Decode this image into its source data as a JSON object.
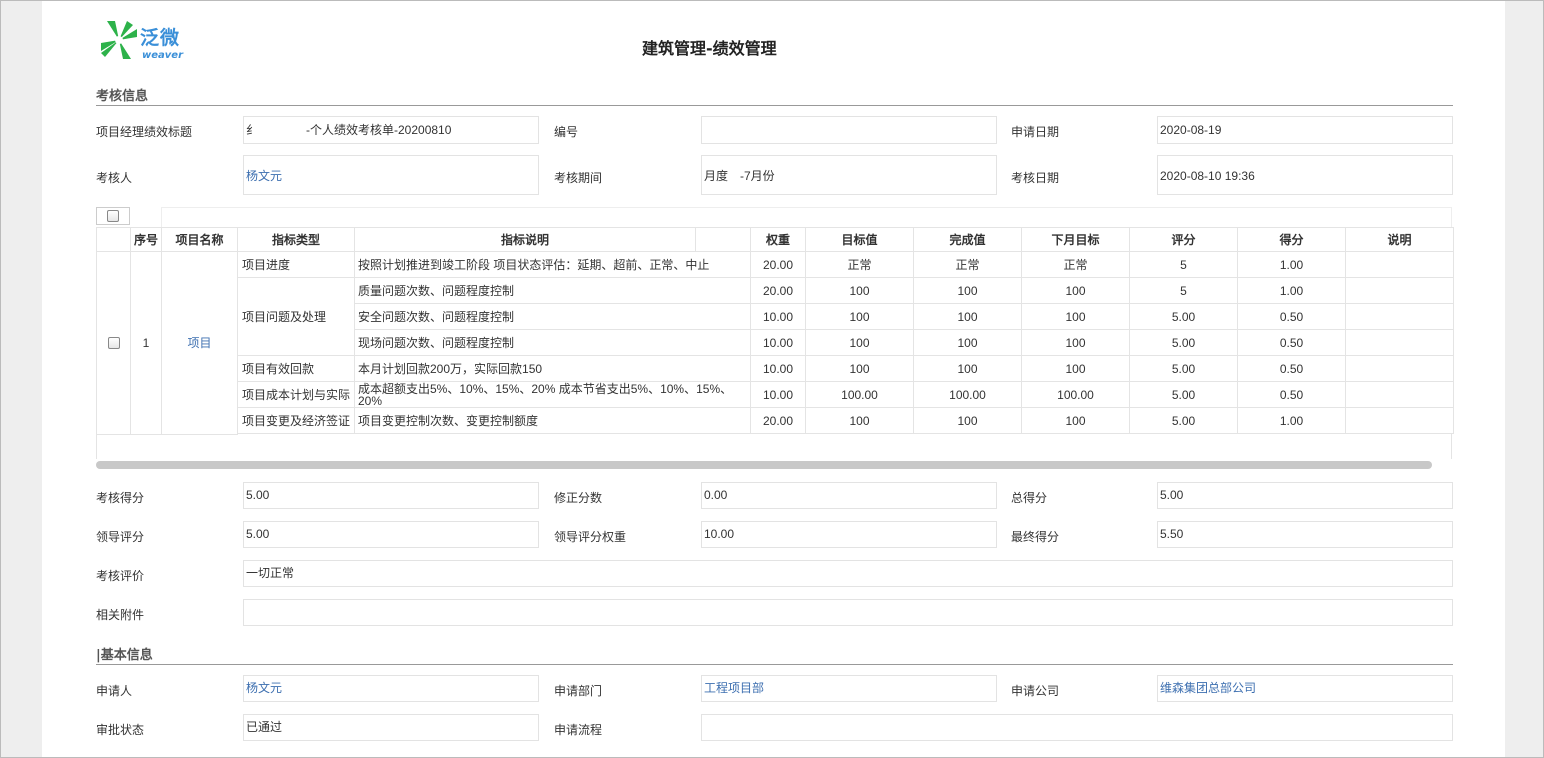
{
  "app": {
    "logo_text": "泛微",
    "logo_sub": "weaver",
    "title": "建筑管理-绩效管理"
  },
  "colors": {
    "link": "#3d6fb0",
    "logo": "#3a8fd8",
    "logo_green": "#2db24a"
  },
  "icons": {
    "logo": "weaver-pinwheel-icon",
    "checkbox": "checkbox-icon"
  },
  "section_assess": {
    "title": "考核信息",
    "fields": {
      "pm_title_label": "项目经理绩效标题",
      "pm_title_value": "-个人绩效考核单-20200810",
      "pm_title_prefix": "纟",
      "number_label": "编号",
      "number_value": "",
      "apply_date_label": "申请日期",
      "apply_date_value": "2020-08-19",
      "assessor_label": "考核人",
      "assessor_value": "杨文元",
      "period_label": "考核期间",
      "period_value": "月度　-7月份",
      "assess_date_label": "考核日期",
      "assess_date_value": "2020-08-10 19:36"
    }
  },
  "grid": {
    "headers": [
      "序号",
      "项目名称",
      "指标类型",
      "指标说明",
      "",
      "权重",
      "目标值",
      "完成值",
      "下月目标",
      "评分",
      "得分",
      "说明"
    ],
    "row_index": "1",
    "project_name": "项目",
    "types": {
      "progress": "项目进度",
      "issues": "项目问题及处理",
      "payment": "项目有效回款",
      "cost": "项目成本计划与实际",
      "change": "项目变更及经济签证"
    },
    "rows": [
      {
        "desc": "按照计划推进到竣工阶段 项目状态评估：延期、超前、正常、中止",
        "weight": "20.00",
        "target": "正常",
        "done": "正常",
        "next": "正常",
        "rating": "5",
        "score": "1.00",
        "note": ""
      },
      {
        "desc": "质量问题次数、问题程度控制",
        "weight": "20.00",
        "target": "100",
        "done": "100",
        "next": "100",
        "rating": "5",
        "score": "1.00",
        "note": ""
      },
      {
        "desc": "安全问题次数、问题程度控制",
        "weight": "10.00",
        "target": "100",
        "done": "100",
        "next": "100",
        "rating": "5.00",
        "score": "0.50",
        "note": ""
      },
      {
        "desc": "现场问题次数、问题程度控制",
        "weight": "10.00",
        "target": "100",
        "done": "100",
        "next": "100",
        "rating": "5.00",
        "score": "0.50",
        "note": ""
      },
      {
        "desc": "本月计划回款200万，实际回款150",
        "weight": "10.00",
        "target": "100",
        "done": "100",
        "next": "100",
        "rating": "5.00",
        "score": "0.50",
        "note": ""
      },
      {
        "desc": "成本超额支出5%、10%、15%、20% 成本节省支出5%、10%、15%、20%",
        "weight": "10.00",
        "target": "100.00",
        "done": "100.00",
        "next": "100.00",
        "rating": "5.00",
        "score": "0.50",
        "note": ""
      },
      {
        "desc": "项目变更控制次数、变更控制额度",
        "weight": "20.00",
        "target": "100",
        "done": "100",
        "next": "100",
        "rating": "5.00",
        "score": "1.00",
        "note": ""
      }
    ]
  },
  "summary": {
    "assess_score_label": "考核得分",
    "assess_score_value": "5.00",
    "adjust_label": "修正分数",
    "adjust_value": "0.00",
    "total_label": "总得分",
    "total_value": "5.00",
    "leader_label": "领导评分",
    "leader_value": "5.00",
    "leader_weight_label": "领导评分权重",
    "leader_weight_value": "10.00",
    "final_label": "最终得分",
    "final_value": "5.50",
    "comment_label": "考核评价",
    "comment_value": "一切正常",
    "attach_label": "相关附件",
    "attach_value": ""
  },
  "section_basic": {
    "title": "|基本信息",
    "applicant_label": "申请人",
    "applicant_value": "杨文元",
    "dept_label": "申请部门",
    "dept_value": "工程项目部",
    "company_label": "申请公司",
    "company_value": "维森集团总部公司",
    "status_label": "审批状态",
    "status_value": "已通过",
    "flow_label": "申请流程",
    "flow_value": ""
  }
}
